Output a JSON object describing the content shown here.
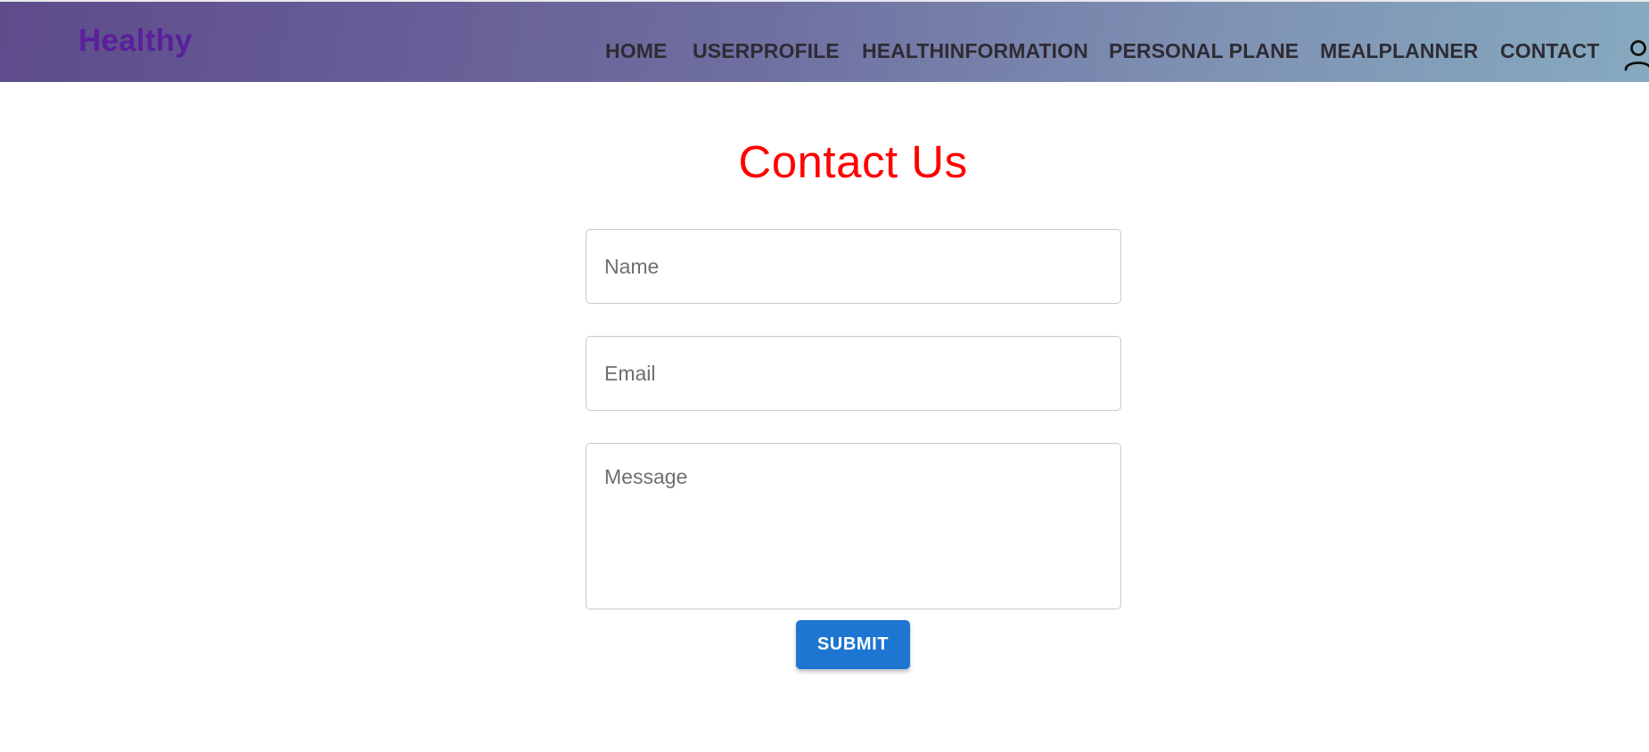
{
  "header": {
    "brand": "Healthy",
    "nav": [
      {
        "label": "HOME"
      },
      {
        "label": "USERPROFILE"
      },
      {
        "label": "HEALTHINFORMATION"
      },
      {
        "label": "PERSONAL PLANE"
      },
      {
        "label": "MEALPLANNER"
      },
      {
        "label": "CONTACT"
      }
    ],
    "user_icon": "user-icon"
  },
  "main": {
    "title": "Contact Us",
    "form": {
      "name": {
        "placeholder": "Name",
        "value": ""
      },
      "email": {
        "placeholder": "Email",
        "value": ""
      },
      "message": {
        "placeholder": "Message",
        "value": ""
      },
      "submit_label": "SUBMIT"
    }
  },
  "colors": {
    "brand": "#5b1f9c",
    "title": "#ff0000",
    "submit_bg": "#1c76d2"
  }
}
